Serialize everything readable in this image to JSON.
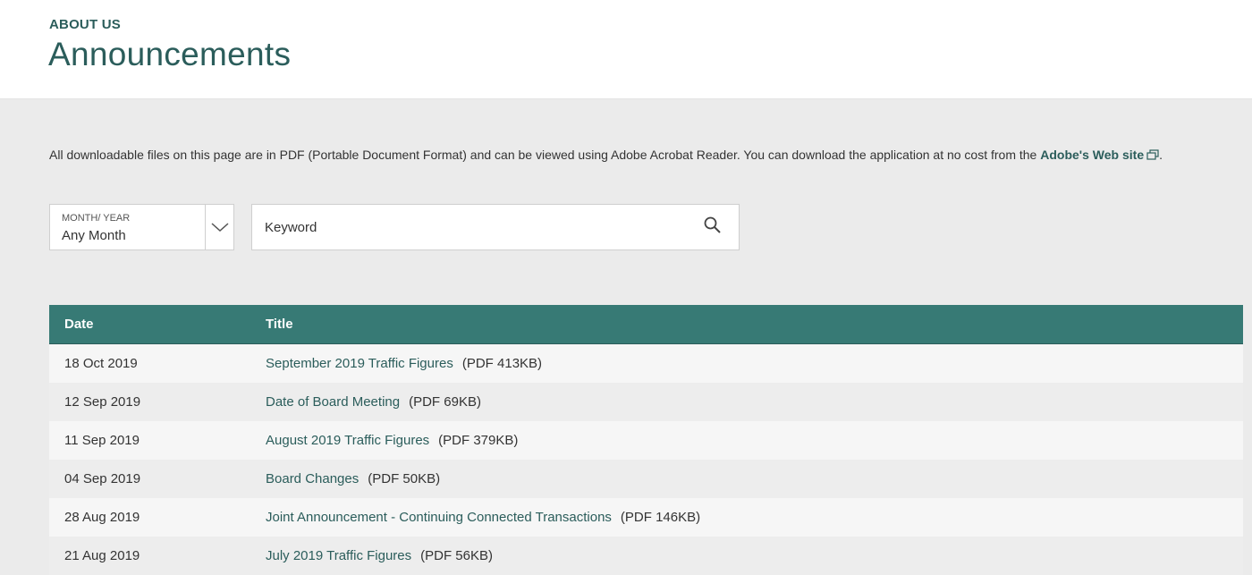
{
  "header": {
    "kicker": "ABOUT US",
    "title": "Announcements"
  },
  "notice": {
    "text": "All downloadable files on this page are in PDF (Portable Document Format) and can be viewed using Adobe Acrobat Reader. You can download the application at no cost from the ",
    "link_label": "Adobe's Web site",
    "end": "."
  },
  "filter": {
    "month_label": "MONTH/ YEAR",
    "month_value": "Any Month",
    "keyword_placeholder": "Keyword"
  },
  "table": {
    "headers": [
      "Date",
      "Title"
    ],
    "rows": [
      {
        "date": "18 Oct 2019",
        "title": "September 2019 Traffic Figures",
        "size": "(PDF 413KB)"
      },
      {
        "date": "12 Sep 2019",
        "title": "Date of Board Meeting",
        "size": "(PDF 69KB)"
      },
      {
        "date": "11 Sep 2019",
        "title": "August 2019 Traffic Figures",
        "size": "(PDF 379KB)"
      },
      {
        "date": "04 Sep 2019",
        "title": "Board Changes",
        "size": "(PDF 50KB)"
      },
      {
        "date": "28 Aug 2019",
        "title": "Joint Announcement - Continuing Connected Transactions",
        "size": "(PDF 146KB)"
      },
      {
        "date": "21 Aug 2019",
        "title": "July 2019 Traffic Figures",
        "size": "(PDF 56KB)"
      }
    ]
  },
  "colors": {
    "accent": "#2b5d5b",
    "table_header": "#377a75",
    "background": "#ebebeb"
  },
  "icons": {
    "external_link": "external-link-icon",
    "chevron": "chevron-down-icon",
    "search": "search-icon"
  }
}
